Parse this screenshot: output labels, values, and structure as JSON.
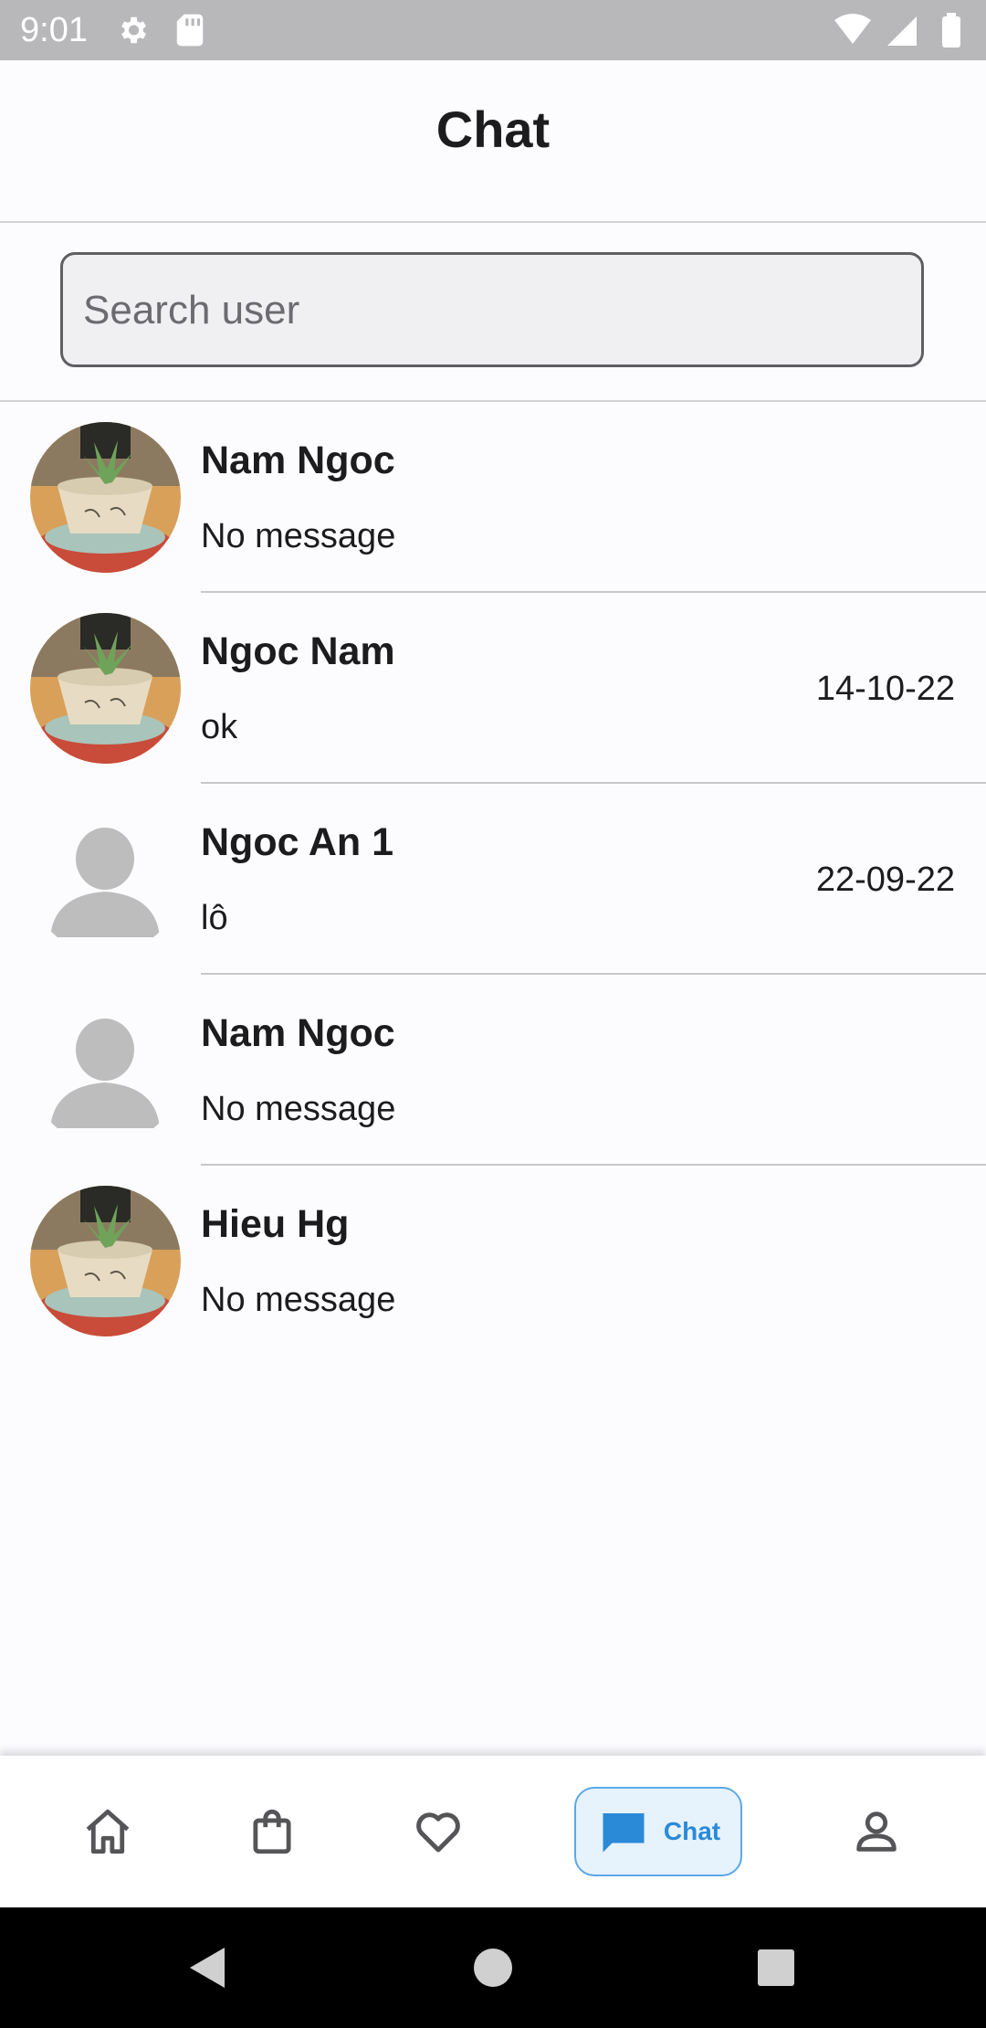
{
  "status_bar": {
    "time": "9:01",
    "icons": [
      "gear-icon",
      "sd-card-icon",
      "wifi-icon",
      "signal-icon",
      "battery-icon"
    ]
  },
  "header": {
    "title": "Chat"
  },
  "search": {
    "placeholder": "Search user",
    "value": ""
  },
  "chats": [
    {
      "name": "Nam Ngoc",
      "message": "No message",
      "date": "",
      "avatar": "plant-photo"
    },
    {
      "name": "Ngoc Nam",
      "message": "ok",
      "date": "14-10-22",
      "avatar": "plant-photo"
    },
    {
      "name": "Ngoc An 1",
      "message": "lô",
      "date": "22-09-22",
      "avatar": "default-person"
    },
    {
      "name": "Nam Ngoc",
      "message": "No message",
      "date": "",
      "avatar": "default-person"
    },
    {
      "name": "Hieu Hg",
      "message": "No message",
      "date": "",
      "avatar": "plant-photo"
    }
  ],
  "bottom_nav": {
    "items": [
      {
        "icon": "home-icon",
        "label": "",
        "active": false
      },
      {
        "icon": "shopping-bag-icon",
        "label": "",
        "active": false
      },
      {
        "icon": "heart-icon",
        "label": "",
        "active": false
      },
      {
        "icon": "chat-icon",
        "label": "Chat",
        "active": true
      },
      {
        "icon": "profile-icon",
        "label": "",
        "active": false
      }
    ]
  },
  "colors": {
    "accent": "#2a8ad8",
    "active_pill_bg": "#e6f2fc",
    "status_bar": "#b8b8bb",
    "placeholder_avatar": "#bdbdbd"
  }
}
